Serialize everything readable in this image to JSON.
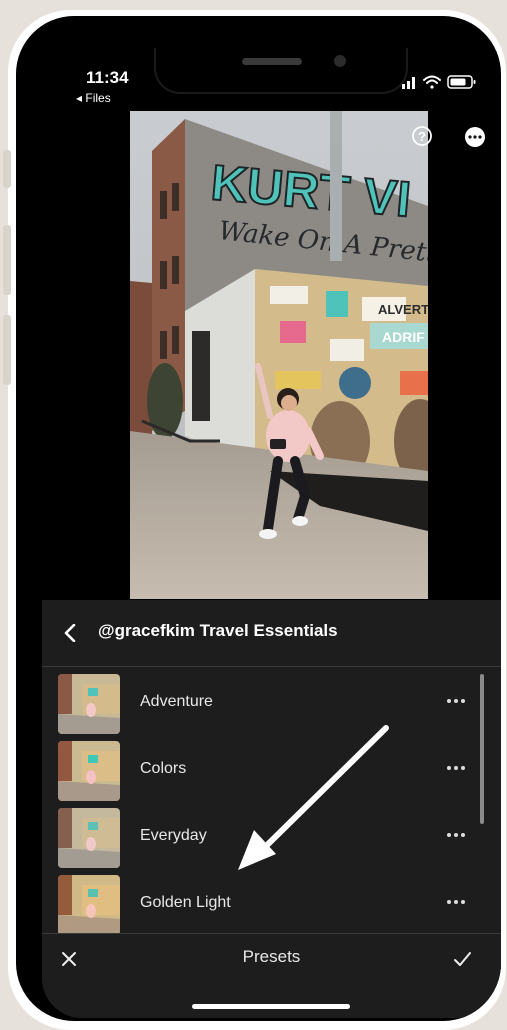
{
  "status_bar": {
    "time": "11:34",
    "back_app": "◂ Files"
  },
  "photo": {
    "sign_line1": "KURT VI",
    "sign_line2": "Wake On A Pretty",
    "mural_words": [
      "ALVERT",
      "ADRIF"
    ]
  },
  "panel": {
    "group_title": "@gracefkim Travel Essentials",
    "presets": [
      {
        "label": "Adventure",
        "more": "•••"
      },
      {
        "label": "Colors",
        "more": "•••"
      },
      {
        "label": "Everyday",
        "more": "•••"
      },
      {
        "label": "Golden Light",
        "more": "•••"
      }
    ]
  },
  "bottom_bar": {
    "title": "Presets"
  },
  "colors": {
    "panel_bg": "#1d1d1d",
    "mural_teal": "#4fc3b9",
    "page_bg": "#e6e1da"
  },
  "icons": [
    "help-icon",
    "more-icon",
    "back-chevron-icon",
    "more-dots-icon",
    "close-icon",
    "checkmark-icon",
    "arrow-annotation"
  ]
}
